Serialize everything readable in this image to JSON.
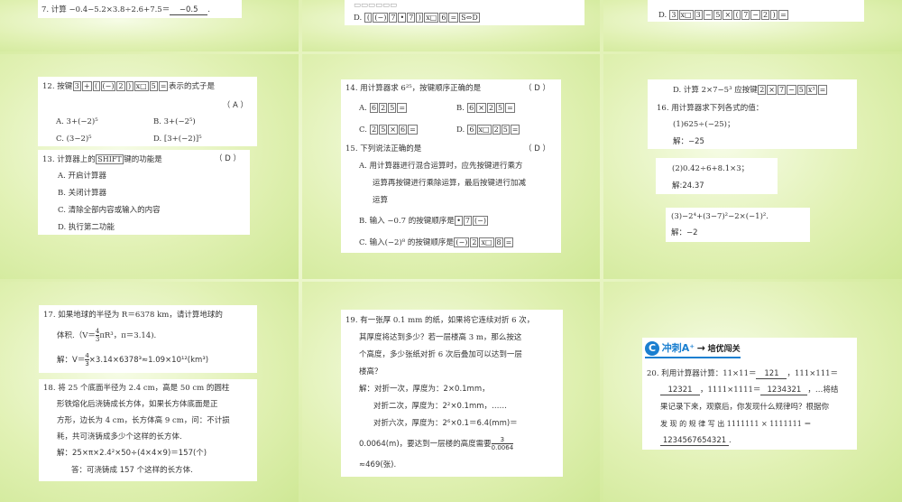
{
  "slides": {
    "s1": {
      "q7": "7. 计算 −0.4−5.2×3.8÷2.6+7.5＝",
      "q7_ans": "−0.5",
      "q7_end": "."
    },
    "s2": {
      "d_label": "D.",
      "d_keys": [
        "(",
        "(−)",
        "7",
        "•",
        "7",
        ")",
        "x□",
        "6",
        "=",
        "S⇔D"
      ]
    },
    "s3": {
      "d_label": "D.",
      "d_keys": [
        "3",
        "x□",
        "3",
        "−",
        "5",
        "×",
        "(",
        "7",
        "−",
        "2",
        ")",
        "="
      ]
    },
    "s4": {
      "q12_prefix": "12. 按键",
      "q12_keys": [
        "3",
        "+",
        "(",
        "(−)",
        "2",
        ")",
        "x□",
        "5",
        "="
      ],
      "q12_suffix": "表示的式子是",
      "q12_ans": "（ A ）",
      "q12_a": "A. 3+(−2)⁵",
      "q12_b": "B. 3+(−2⁵)",
      "q12_c": "C. (3−2)⁵",
      "q12_d": "D. [3+(−2)]⁵",
      "q13_prefix": "13. 计算器上的",
      "q13_key": "SHIFT",
      "q13_suffix": "键的功能是",
      "q13_ans": "（ D ）",
      "q13_a": "A. 开启计算器",
      "q13_b": "B. 关闭计算器",
      "q13_c": "C. 清除全部内容或输入的内容",
      "q13_d": "D. 执行第二功能"
    },
    "s5": {
      "q14": "14. 用计算器求 6²⁵，按键顺序正确的是",
      "q14_ans": "（ D ）",
      "q14_a_label": "A.",
      "q14_a": [
        "6",
        "2",
        "5",
        "="
      ],
      "q14_b_label": "B.",
      "q14_b": [
        "6",
        "×",
        "2",
        "5",
        "="
      ],
      "q14_c_label": "C.",
      "q14_c": [
        "2",
        "5",
        "×",
        "6",
        "="
      ],
      "q14_d_label": "D.",
      "q14_d": [
        "6",
        "x□",
        "2",
        "5",
        "="
      ],
      "q15": "15. 下列说法正确的是",
      "q15_ans": "（ D ）",
      "q15_a1": "A. 用计算器进行混合运算时，应先按键进行乘方",
      "q15_a2": "运算再按键进行乘除运算，最后按键进行加减",
      "q15_a3": "运算",
      "q15_b": "B. 输入 −0.7 的按键顺序是",
      "q15_b_keys": [
        "•",
        "7",
        "(−)"
      ],
      "q15_c": "C. 输入(−2)⁸ 的按键顺序是",
      "q15_c_keys": [
        "(−)",
        "2",
        "x□",
        "8",
        "="
      ]
    },
    "s6": {
      "d_prefix": "D. 计算 2×7−5³ 应按键",
      "d_keys": [
        "2",
        "×",
        "7",
        "−",
        "5",
        "x³",
        "="
      ],
      "q16": "16. 用计算器求下列各式的值：",
      "p1": "(1)625÷(−25)；",
      "p1_ans": "解：−25",
      "p2": "(2)0.42÷6+8.1×3；",
      "p2_ans": "解:24.37",
      "p3": "(3)−2⁴+(3−7)²−2×(−1)².",
      "p3_ans": "解：−2"
    },
    "s7": {
      "q17_1": "17. 如果地球的半径为 R＝6378 km，请计算地球的",
      "q17_2a": "体积.（V＝",
      "q17_2b": "πR³，π＝3.14).",
      "frac_num": "4",
      "frac_den": "3",
      "q17_ans_a": "解：V＝",
      "q17_ans_b": "×3.14×6378³≈1.09×10¹²(km³)",
      "q18_1": "18. 将 25 个底面半径为 2.4 cm，高是 50 cm 的圆柱",
      "q18_2": "形铁熔化后浇铸成长方体，如果长方体底面是正",
      "q18_3": "方形，边长为 4 cm，长方体高 9 cm，问：不计损",
      "q18_4": "耗，共可浇铸成多少个这样的长方体.",
      "q18_ans": "解：25×π×2.4²×50÷(4×4×9)＝157(个)",
      "q18_ans2": "答：可浇铸成 157 个这样的长方体."
    },
    "s8": {
      "q19_1": "19. 有一张厚 0.1 mm 的纸，如果将它连续对折 6 次，",
      "q19_2": "其厚度将达到多少？若一层楼高 3 m，那么按这",
      "q19_3": "个高度，多少张纸对折 6 次后叠加可以达到一层",
      "q19_4": "楼高？",
      "a1": "解：对折一次，厚度为：2×0.1mm，",
      "a2": "对折二次，厚度为：2²×0.1mm，……",
      "a3": "对折六次，厚度为：2⁶×0.1＝6.4(mm)＝",
      "a4": "0.0064(m)，要达到一层楼的高度需要",
      "a4_num": "3",
      "a4_den": "0.0064",
      "a5": "≈469(张)."
    },
    "s9": {
      "badge": "C",
      "banner_title": "冲刺A⁺",
      "banner_arrow": "→",
      "banner_sub": "培优闯关",
      "q20_1a": "20. 利用计算器计算：11×11＝",
      "b1": "121",
      "q20_1b": "，111×111＝",
      "b2": "12321",
      "q20_2a": "，1111×1111＝",
      "b3": "1234321",
      "q20_2b": "，…将结",
      "q20_3": "果记录下来，观察后，你发现什么规律吗？根据你",
      "q20_4": "发 现 的 规 律 写 出 1111111 × 1111111 ＝",
      "b4": "1234567654321",
      "q20_end": "."
    }
  }
}
